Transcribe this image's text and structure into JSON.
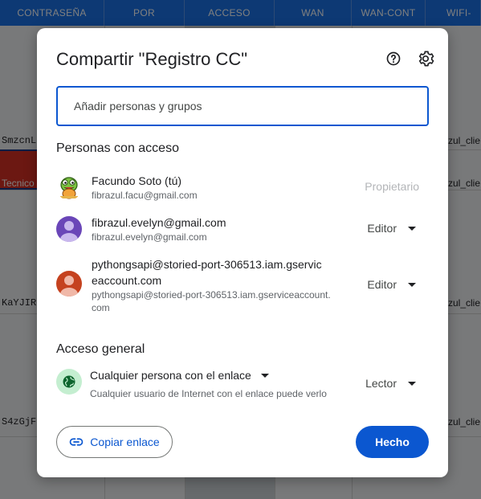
{
  "background_sheet": {
    "headers": [
      "CONTRASEÑA",
      "POR",
      "ACCESO",
      "WAN",
      "WAN-CONT",
      "WIFI-"
    ],
    "left_cells": [
      "SmzcnL",
      "Tecnico",
      "KaYJIR",
      "S4zGjF"
    ],
    "right_cells": [
      "zul_clie",
      "zul_clie",
      "zul_clie",
      "zul_clie"
    ],
    "header_color": "#1a73e8",
    "highlight_color": "#d93025"
  },
  "dialog": {
    "title": "Compartir \"Registro CC\"",
    "help_icon": "help-circle-icon",
    "settings_icon": "gear-icon",
    "search_placeholder": "Añadir personas y grupos",
    "people_heading": "Personas con acceso",
    "people": [
      {
        "name": "Facundo Soto (tú)",
        "email": "fibrazul.facu@gmail.com",
        "role": "Propietario",
        "avatar": "frog-avatar-icon"
      },
      {
        "name": "fibrazul.evelyn@gmail.com",
        "email": "fibrazul.evelyn@gmail.com",
        "role": "Editor",
        "avatar": "person-avatar-icon",
        "avatar_color": "#6a46b8"
      },
      {
        "name_line1": "pythongsapi@storied-port-306513.iam.gservic",
        "name_line2": "eaccount.com",
        "email_line1": "pythongsapi@storied-port-306513.iam.gserviceaccount.",
        "email_line2": "com",
        "role": "Editor",
        "avatar": "person-avatar-icon",
        "avatar_color": "#c5421f"
      }
    ],
    "general_heading": "Acceso general",
    "general_access": {
      "selection": "Cualquier persona con el enlace",
      "description": "Cualquier usuario de Internet con el enlace puede verlo",
      "role": "Lector",
      "icon": "globe-icon"
    },
    "copy_link_label": "Copiar enlace",
    "done_label": "Hecho",
    "accent_color": "#0b57d0"
  }
}
